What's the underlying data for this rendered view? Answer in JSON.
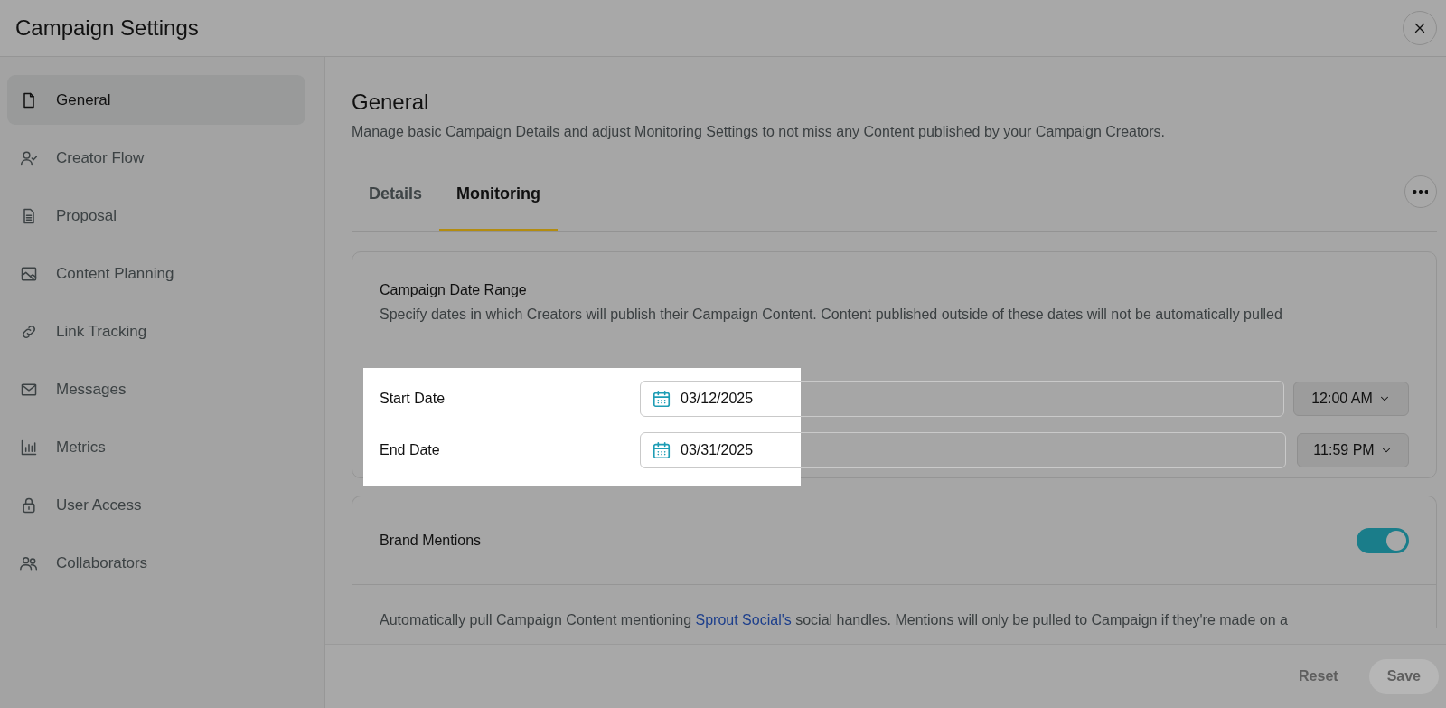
{
  "window": {
    "title": "Campaign Settings"
  },
  "sidebar": {
    "items": [
      {
        "label": "General",
        "selected": true
      },
      {
        "label": "Creator Flow",
        "selected": false
      },
      {
        "label": "Proposal",
        "selected": false
      },
      {
        "label": "Content Planning",
        "selected": false
      },
      {
        "label": "Link Tracking",
        "selected": false
      },
      {
        "label": "Messages",
        "selected": false
      },
      {
        "label": "Metrics",
        "selected": false
      },
      {
        "label": "User Access",
        "selected": false
      },
      {
        "label": "Collaborators",
        "selected": false
      }
    ]
  },
  "page": {
    "title": "General",
    "description": "Manage basic Campaign Details and adjust Monitoring Settings to not miss any Content published by your Campaign Creators."
  },
  "tabs": [
    {
      "label": "Details",
      "selected": false
    },
    {
      "label": "Monitoring",
      "selected": true
    }
  ],
  "date_range": {
    "title": "Campaign Date Range",
    "description": "Specify dates in which Creators will publish their Campaign Content. Content published outside of these dates will not be automatically pulled",
    "highlighted": true,
    "rows": [
      {
        "label": "Start Date",
        "date": "03/12/2025",
        "time": "12:00 AM"
      },
      {
        "label": "End Date",
        "date": "03/31/2025",
        "time": "11:59 PM"
      }
    ]
  },
  "brand_mentions": {
    "title": "Brand Mentions",
    "on": true,
    "description_start": "Automatically pull Campaign Content mentioning ",
    "link": "Sprout Social's",
    "description_end": " social handles. Mentions will only be pulled to Campaign if they're made on a"
  },
  "footer": {
    "buttons": [
      {
        "label": "Reset",
        "disabled": true
      },
      {
        "label": "Save",
        "disabled": true
      }
    ]
  }
}
